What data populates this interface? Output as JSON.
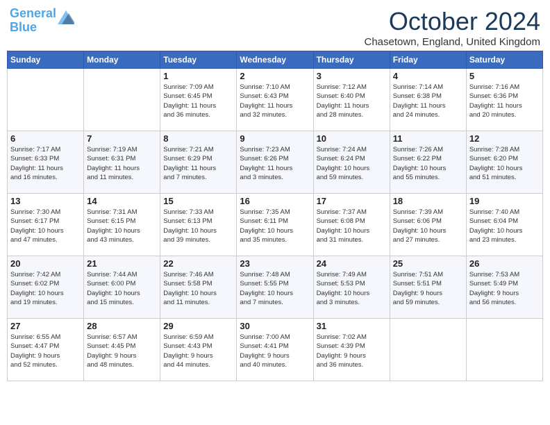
{
  "header": {
    "logo_line1": "General",
    "logo_line2": "Blue",
    "month": "October 2024",
    "location": "Chasetown, England, United Kingdom"
  },
  "weekdays": [
    "Sunday",
    "Monday",
    "Tuesday",
    "Wednesday",
    "Thursday",
    "Friday",
    "Saturday"
  ],
  "weeks": [
    [
      {
        "day": "",
        "info": ""
      },
      {
        "day": "",
        "info": ""
      },
      {
        "day": "1",
        "info": "Sunrise: 7:09 AM\nSunset: 6:45 PM\nDaylight: 11 hours\nand 36 minutes."
      },
      {
        "day": "2",
        "info": "Sunrise: 7:10 AM\nSunset: 6:43 PM\nDaylight: 11 hours\nand 32 minutes."
      },
      {
        "day": "3",
        "info": "Sunrise: 7:12 AM\nSunset: 6:40 PM\nDaylight: 11 hours\nand 28 minutes."
      },
      {
        "day": "4",
        "info": "Sunrise: 7:14 AM\nSunset: 6:38 PM\nDaylight: 11 hours\nand 24 minutes."
      },
      {
        "day": "5",
        "info": "Sunrise: 7:16 AM\nSunset: 6:36 PM\nDaylight: 11 hours\nand 20 minutes."
      }
    ],
    [
      {
        "day": "6",
        "info": "Sunrise: 7:17 AM\nSunset: 6:33 PM\nDaylight: 11 hours\nand 16 minutes."
      },
      {
        "day": "7",
        "info": "Sunrise: 7:19 AM\nSunset: 6:31 PM\nDaylight: 11 hours\nand 11 minutes."
      },
      {
        "day": "8",
        "info": "Sunrise: 7:21 AM\nSunset: 6:29 PM\nDaylight: 11 hours\nand 7 minutes."
      },
      {
        "day": "9",
        "info": "Sunrise: 7:23 AM\nSunset: 6:26 PM\nDaylight: 11 hours\nand 3 minutes."
      },
      {
        "day": "10",
        "info": "Sunrise: 7:24 AM\nSunset: 6:24 PM\nDaylight: 10 hours\nand 59 minutes."
      },
      {
        "day": "11",
        "info": "Sunrise: 7:26 AM\nSunset: 6:22 PM\nDaylight: 10 hours\nand 55 minutes."
      },
      {
        "day": "12",
        "info": "Sunrise: 7:28 AM\nSunset: 6:20 PM\nDaylight: 10 hours\nand 51 minutes."
      }
    ],
    [
      {
        "day": "13",
        "info": "Sunrise: 7:30 AM\nSunset: 6:17 PM\nDaylight: 10 hours\nand 47 minutes."
      },
      {
        "day": "14",
        "info": "Sunrise: 7:31 AM\nSunset: 6:15 PM\nDaylight: 10 hours\nand 43 minutes."
      },
      {
        "day": "15",
        "info": "Sunrise: 7:33 AM\nSunset: 6:13 PM\nDaylight: 10 hours\nand 39 minutes."
      },
      {
        "day": "16",
        "info": "Sunrise: 7:35 AM\nSunset: 6:11 PM\nDaylight: 10 hours\nand 35 minutes."
      },
      {
        "day": "17",
        "info": "Sunrise: 7:37 AM\nSunset: 6:08 PM\nDaylight: 10 hours\nand 31 minutes."
      },
      {
        "day": "18",
        "info": "Sunrise: 7:39 AM\nSunset: 6:06 PM\nDaylight: 10 hours\nand 27 minutes."
      },
      {
        "day": "19",
        "info": "Sunrise: 7:40 AM\nSunset: 6:04 PM\nDaylight: 10 hours\nand 23 minutes."
      }
    ],
    [
      {
        "day": "20",
        "info": "Sunrise: 7:42 AM\nSunset: 6:02 PM\nDaylight: 10 hours\nand 19 minutes."
      },
      {
        "day": "21",
        "info": "Sunrise: 7:44 AM\nSunset: 6:00 PM\nDaylight: 10 hours\nand 15 minutes."
      },
      {
        "day": "22",
        "info": "Sunrise: 7:46 AM\nSunset: 5:58 PM\nDaylight: 10 hours\nand 11 minutes."
      },
      {
        "day": "23",
        "info": "Sunrise: 7:48 AM\nSunset: 5:55 PM\nDaylight: 10 hours\nand 7 minutes."
      },
      {
        "day": "24",
        "info": "Sunrise: 7:49 AM\nSunset: 5:53 PM\nDaylight: 10 hours\nand 3 minutes."
      },
      {
        "day": "25",
        "info": "Sunrise: 7:51 AM\nSunset: 5:51 PM\nDaylight: 9 hours\nand 59 minutes."
      },
      {
        "day": "26",
        "info": "Sunrise: 7:53 AM\nSunset: 5:49 PM\nDaylight: 9 hours\nand 56 minutes."
      }
    ],
    [
      {
        "day": "27",
        "info": "Sunrise: 6:55 AM\nSunset: 4:47 PM\nDaylight: 9 hours\nand 52 minutes."
      },
      {
        "day": "28",
        "info": "Sunrise: 6:57 AM\nSunset: 4:45 PM\nDaylight: 9 hours\nand 48 minutes."
      },
      {
        "day": "29",
        "info": "Sunrise: 6:59 AM\nSunset: 4:43 PM\nDaylight: 9 hours\nand 44 minutes."
      },
      {
        "day": "30",
        "info": "Sunrise: 7:00 AM\nSunset: 4:41 PM\nDaylight: 9 hours\nand 40 minutes."
      },
      {
        "day": "31",
        "info": "Sunrise: 7:02 AM\nSunset: 4:39 PM\nDaylight: 9 hours\nand 36 minutes."
      },
      {
        "day": "",
        "info": ""
      },
      {
        "day": "",
        "info": ""
      }
    ]
  ]
}
